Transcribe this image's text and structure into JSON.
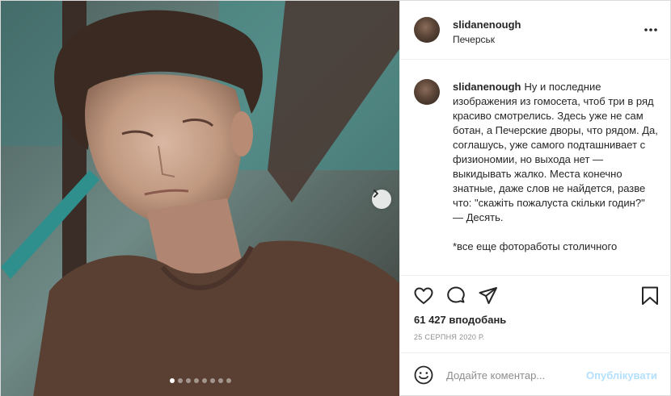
{
  "post": {
    "username": "slidanenough",
    "location": "Печерськ",
    "caption_text": "Ну и последние изображения из гомосета, чтоб три в ряд красиво смотрелись. Здесь уже не сам ботан, а Печерские дворы, что рядом. Да, соглашусь, уже самого подташнивает с физиономии, но выхода нет — выкидывать жалко. Места конечно знатные, даже слов не найдется, разве что: \"скажіть пожалуста скільки годин?\"\n— Десять.",
    "caption_more": "*все еще фотоработы столичного",
    "likes": "61 427 вподобань",
    "date": "25 СЕРПНЯ 2020 Р.",
    "carousel": {
      "total_slides": 8,
      "active_slide": 1
    }
  },
  "comment": {
    "placeholder": "Додайте коментар...",
    "publish_label": "Опублікувати"
  },
  "icons": {
    "more": "more-dots-icon",
    "like": "heart-icon",
    "comment": "comment-icon",
    "share": "paper-plane-icon",
    "save": "bookmark-icon",
    "emoji": "smiley-icon",
    "next": "chevron-right-icon"
  },
  "colors": {
    "text": "#262626",
    "muted": "#8e8e8e",
    "border": "#efefef",
    "publish_disabled": "#b2dffc"
  }
}
